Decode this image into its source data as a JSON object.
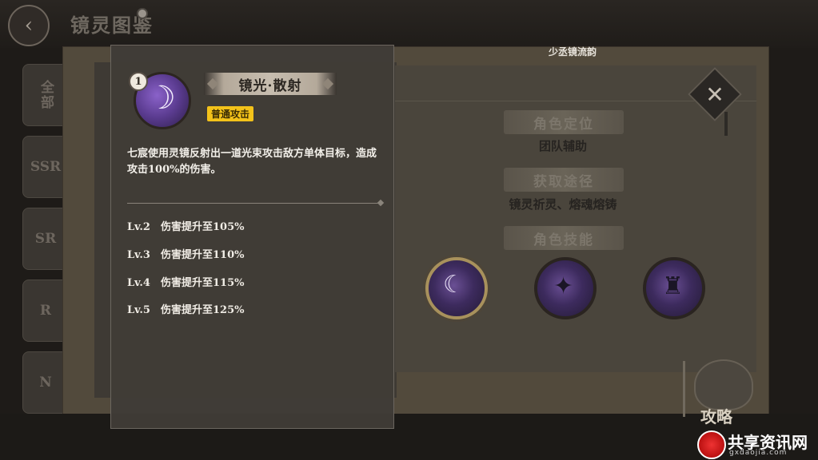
{
  "header": {
    "title": "镜灵图鉴",
    "back_icon": "back-arrow-icon"
  },
  "side_tabs": [
    {
      "label": "全部"
    },
    {
      "label": "SSR"
    },
    {
      "label": "SR"
    },
    {
      "label": "R"
    },
    {
      "label": "N"
    }
  ],
  "character": {
    "name_title": "少丞镜流韵",
    "sections": [
      {
        "heading": "角色定位",
        "value": "团队辅助"
      },
      {
        "heading": "获取途径",
        "value": "镜灵祈灵、熔魂熔铸"
      },
      {
        "heading": "角色技能",
        "value": ""
      }
    ],
    "skill_icons": [
      "skill-1-icon",
      "skill-2-icon",
      "skill-3-icon"
    ]
  },
  "popup": {
    "level": "1",
    "skill_name": "镜光·散射",
    "tag": "普通攻击",
    "description": "七宸使用灵镜反射出一道光束攻击敌方单体目标，造成攻击100%的伤害。",
    "upgrades": [
      {
        "level": "Lv.2",
        "effect": "伤害提升至105%"
      },
      {
        "level": "Lv.3",
        "effect": "伤害提升至110%"
      },
      {
        "level": "Lv.4",
        "effect": "伤害提升至115%"
      },
      {
        "level": "Lv.5",
        "effect": "伤害提升至125%"
      }
    ]
  },
  "footer": {
    "strategy_label": "攻略"
  },
  "watermark": {
    "site_name": "共享资讯网",
    "url": "gxdaojia.com"
  }
}
